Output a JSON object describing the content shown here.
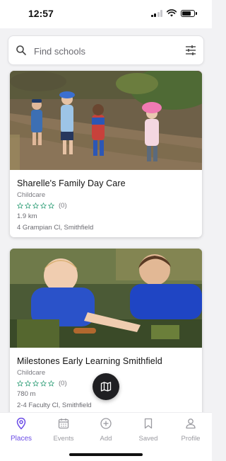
{
  "status_bar": {
    "time": "12:57"
  },
  "search": {
    "placeholder": "Find schools"
  },
  "listings": [
    {
      "name": "Sharelle's Family Day Care",
      "type": "Childcare",
      "rating_count": "(0)",
      "distance": "1.9 km",
      "address": "4 Grampian Cl, Smithfield"
    },
    {
      "name": "Milestones Early Learning Smithfield",
      "type": "Childcare",
      "rating_count": "(0)",
      "distance": "780 m",
      "address": "2-4 Faculty Cl, Smithfield"
    }
  ],
  "tabs": [
    {
      "label": "Places",
      "icon": "location-pin-icon",
      "active": true
    },
    {
      "label": "Events",
      "icon": "calendar-icon",
      "active": false
    },
    {
      "label": "Add",
      "icon": "plus-circle-icon",
      "active": false
    },
    {
      "label": "Saved",
      "icon": "bookmark-icon",
      "active": false
    },
    {
      "label": "Profile",
      "icon": "person-icon",
      "active": false
    }
  ],
  "colors": {
    "accent": "#6b4ce6",
    "star": "#2e9e77",
    "fab": "#1f1f22"
  }
}
